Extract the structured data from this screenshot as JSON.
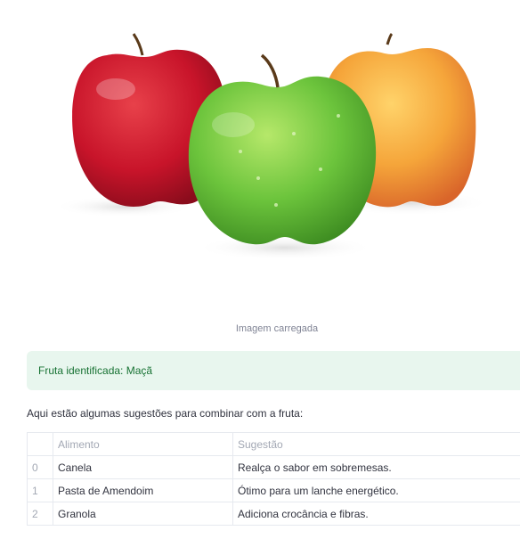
{
  "image": {
    "subject": "three apples: red, green, yellow",
    "caption": "Imagem carregada"
  },
  "alert": {
    "text": "Fruta identificada: Maçã",
    "color": "#177233",
    "background": "#e8f6ee"
  },
  "intro": "Aqui estão algumas sugestões para combinar com a fruta:",
  "table": {
    "headers": [
      "",
      "Alimento",
      "Sugestão"
    ],
    "rows": [
      {
        "index": "0",
        "alimento": "Canela",
        "sugestao": "Realça o sabor em sobremesas."
      },
      {
        "index": "1",
        "alimento": "Pasta de Amendoim",
        "sugestao": "Ótimo para um lanche energético."
      },
      {
        "index": "2",
        "alimento": "Granola",
        "sugestao": "Adiciona crocância e fibras."
      }
    ]
  }
}
